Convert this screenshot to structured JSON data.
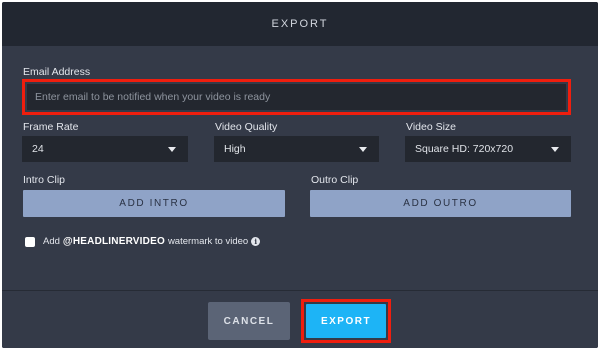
{
  "dialog": {
    "title": "EXPORT"
  },
  "form": {
    "email": {
      "label": "Email Address",
      "placeholder": "Enter email to be notified when your video is ready",
      "value": ""
    },
    "frame_rate": {
      "label": "Frame Rate",
      "selected": "24"
    },
    "video_quality": {
      "label": "Video Quality",
      "selected": "High"
    },
    "video_size": {
      "label": "Video Size",
      "selected": "Square HD: 720x720"
    },
    "intro_clip": {
      "label": "Intro Clip",
      "button": "ADD INTRO"
    },
    "outro_clip": {
      "label": "Outro Clip",
      "button": "ADD OUTRO"
    },
    "watermark": {
      "prefix": "Add",
      "brand": "@HEADLINERVIDEO",
      "suffix": "watermark to video",
      "checked": false,
      "info_icon": "info-icon"
    }
  },
  "footer": {
    "cancel_label": "CANCEL",
    "export_label": "EXPORT"
  },
  "colors": {
    "background": "#343a48",
    "header": "#222731",
    "input": "#23272f",
    "clip_button": "#8fa3c7",
    "cancel_button": "#5b6476",
    "export_button": "#1db4f6",
    "highlight": "#ef1e0e"
  }
}
